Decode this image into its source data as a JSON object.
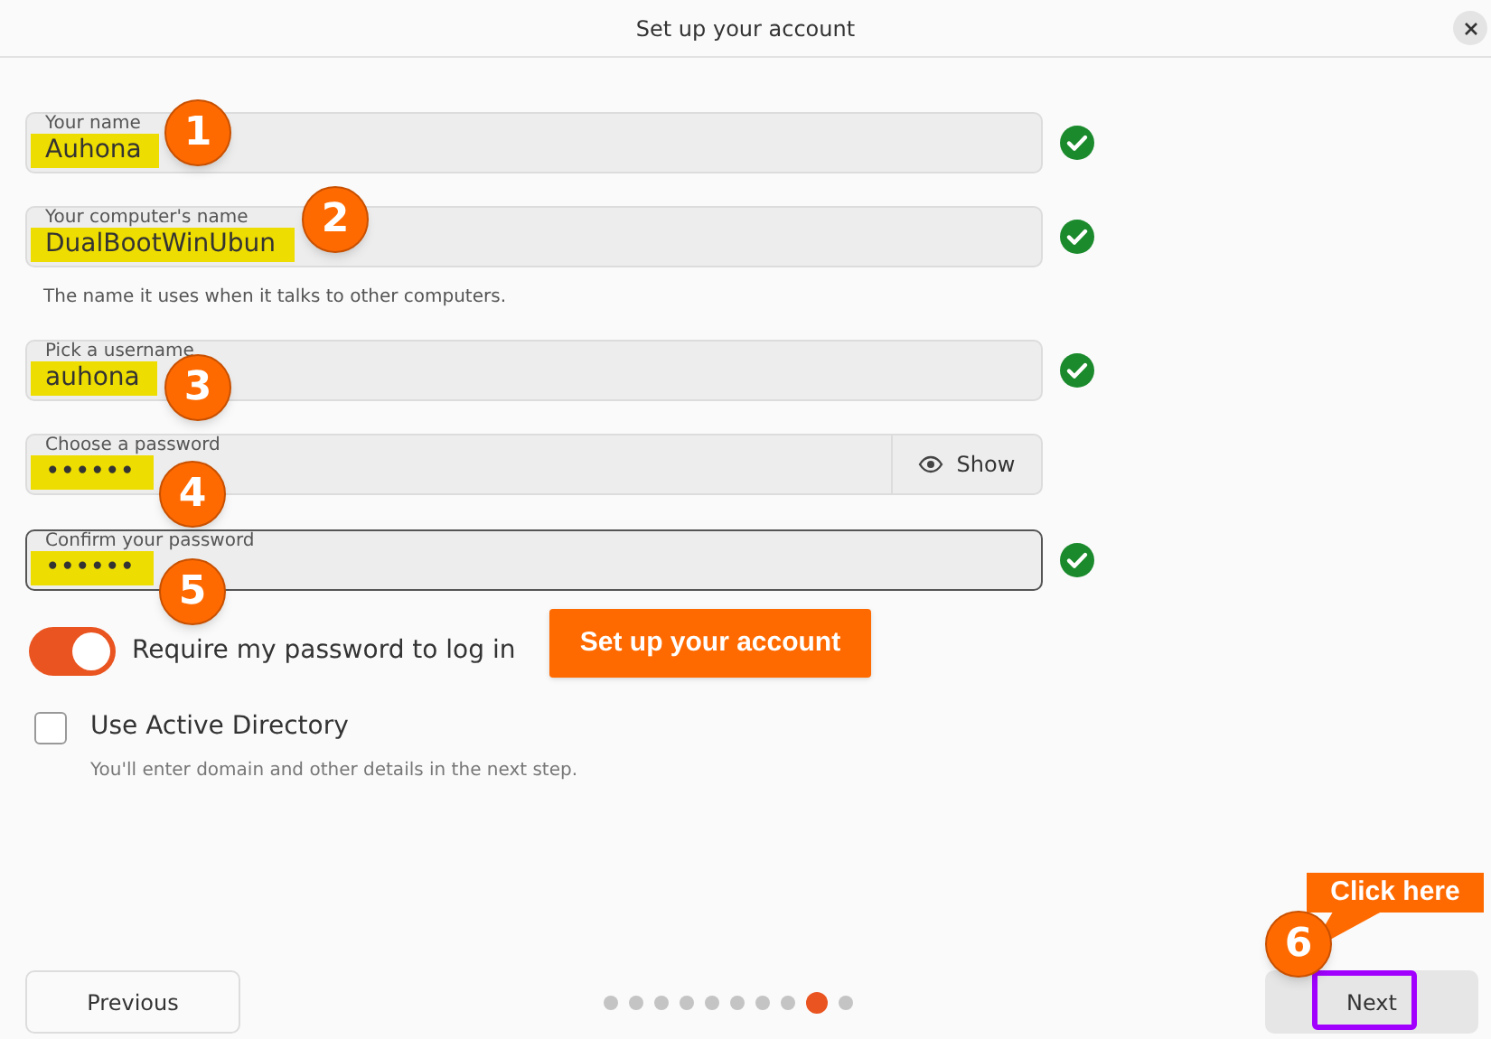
{
  "window": {
    "title": "Set up your account"
  },
  "fields": [
    {
      "label": "Your name",
      "value": "Auhona",
      "valid": true,
      "focused": false,
      "marker": "1"
    },
    {
      "label": "Your computer's name",
      "value": "DualBootWinUbun",
      "valid": true,
      "focused": false,
      "marker": "2",
      "hint": "The name it uses when it talks to other computers."
    },
    {
      "label": "Pick a username",
      "value": "auhona",
      "valid": true,
      "focused": false,
      "marker": "3"
    },
    {
      "label": "Choose a password",
      "value": "••••••",
      "valid": false,
      "focused": false,
      "marker": "4",
      "show_button": "Show"
    },
    {
      "label": "Confirm your password",
      "value": "••••••",
      "valid": true,
      "focused": true,
      "marker": "5"
    }
  ],
  "require_password": {
    "label": "Require my password to log in",
    "on": true
  },
  "active_directory": {
    "label": "Use Active Directory",
    "checked": false,
    "hint": "You'll enter domain and other details in the next step."
  },
  "callout": "Set up your account",
  "next_callout": {
    "text": "Click here",
    "marker": "6"
  },
  "footer": {
    "previous": "Previous",
    "next": "Next",
    "next_highlighted": true,
    "steps": [
      {
        "selected": false
      },
      {
        "selected": false
      },
      {
        "selected": false
      },
      {
        "selected": false
      },
      {
        "selected": false
      },
      {
        "selected": false
      },
      {
        "selected": false
      },
      {
        "selected": false
      },
      {
        "selected": true
      },
      {
        "selected": false
      }
    ]
  }
}
